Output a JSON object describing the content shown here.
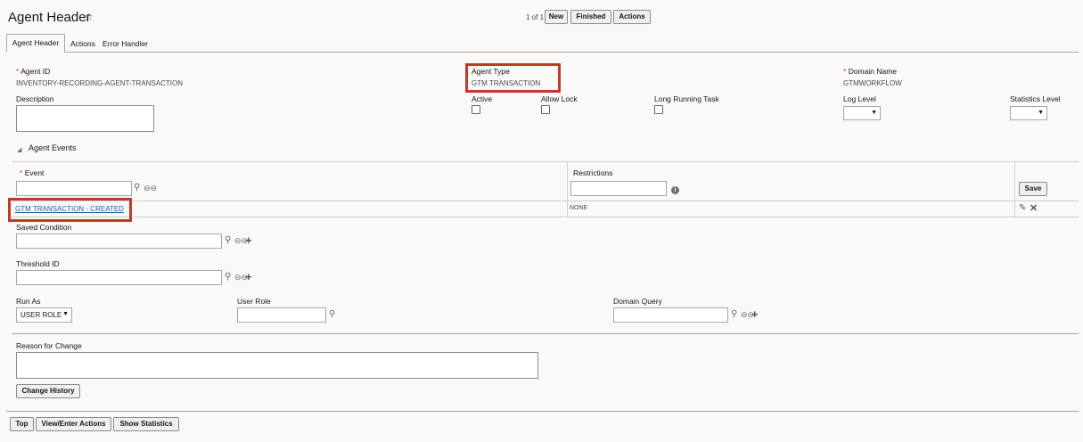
{
  "header": {
    "title": "Agent Header",
    "pager": "1 of 1",
    "buttons": {
      "new": "New",
      "finished": "Finished",
      "actions": "Actions"
    }
  },
  "tabs": [
    "Agent Header",
    "Actions",
    "Error Handler"
  ],
  "fields": {
    "agent_id_label": "Agent ID",
    "agent_id_value": "INVENTORY-RECORDING-AGENT-TRANSACTION",
    "agent_type_label": "Agent Type",
    "agent_type_value": "GTM TRANSACTION",
    "domain_label": "Domain Name",
    "domain_value": "GTMWORKFLOW",
    "description_label": "Description",
    "active_label": "Active",
    "allow_lock_label": "Allow Lock",
    "long_running_label": "Long Running Task",
    "log_level_label": "Log Level",
    "stats_level_label": "Statistics Level"
  },
  "events": {
    "section_title": "Agent Events",
    "col_event": "Event",
    "col_restrictions": "Restrictions",
    "save_label": "Save",
    "row_event": "GTM TRANSACTION - CREATED",
    "row_restriction": "NONE"
  },
  "details": {
    "saved_condition_label": "Saved Condition",
    "threshold_label": "Threshold ID",
    "run_as_label": "Run As",
    "run_as_value": "USER ROLE",
    "user_role_label": "User Role",
    "domain_query_label": "Domain Query",
    "reason_label": "Reason for Change",
    "change_history_label": "Change History"
  },
  "footer": {
    "top": "Top",
    "view_enter_actions": "View/Enter Actions",
    "show_statistics": "Show Statistics"
  },
  "colors": {
    "highlight": "#c0392b",
    "required": "#c74634",
    "link": "#2a5aa8"
  }
}
